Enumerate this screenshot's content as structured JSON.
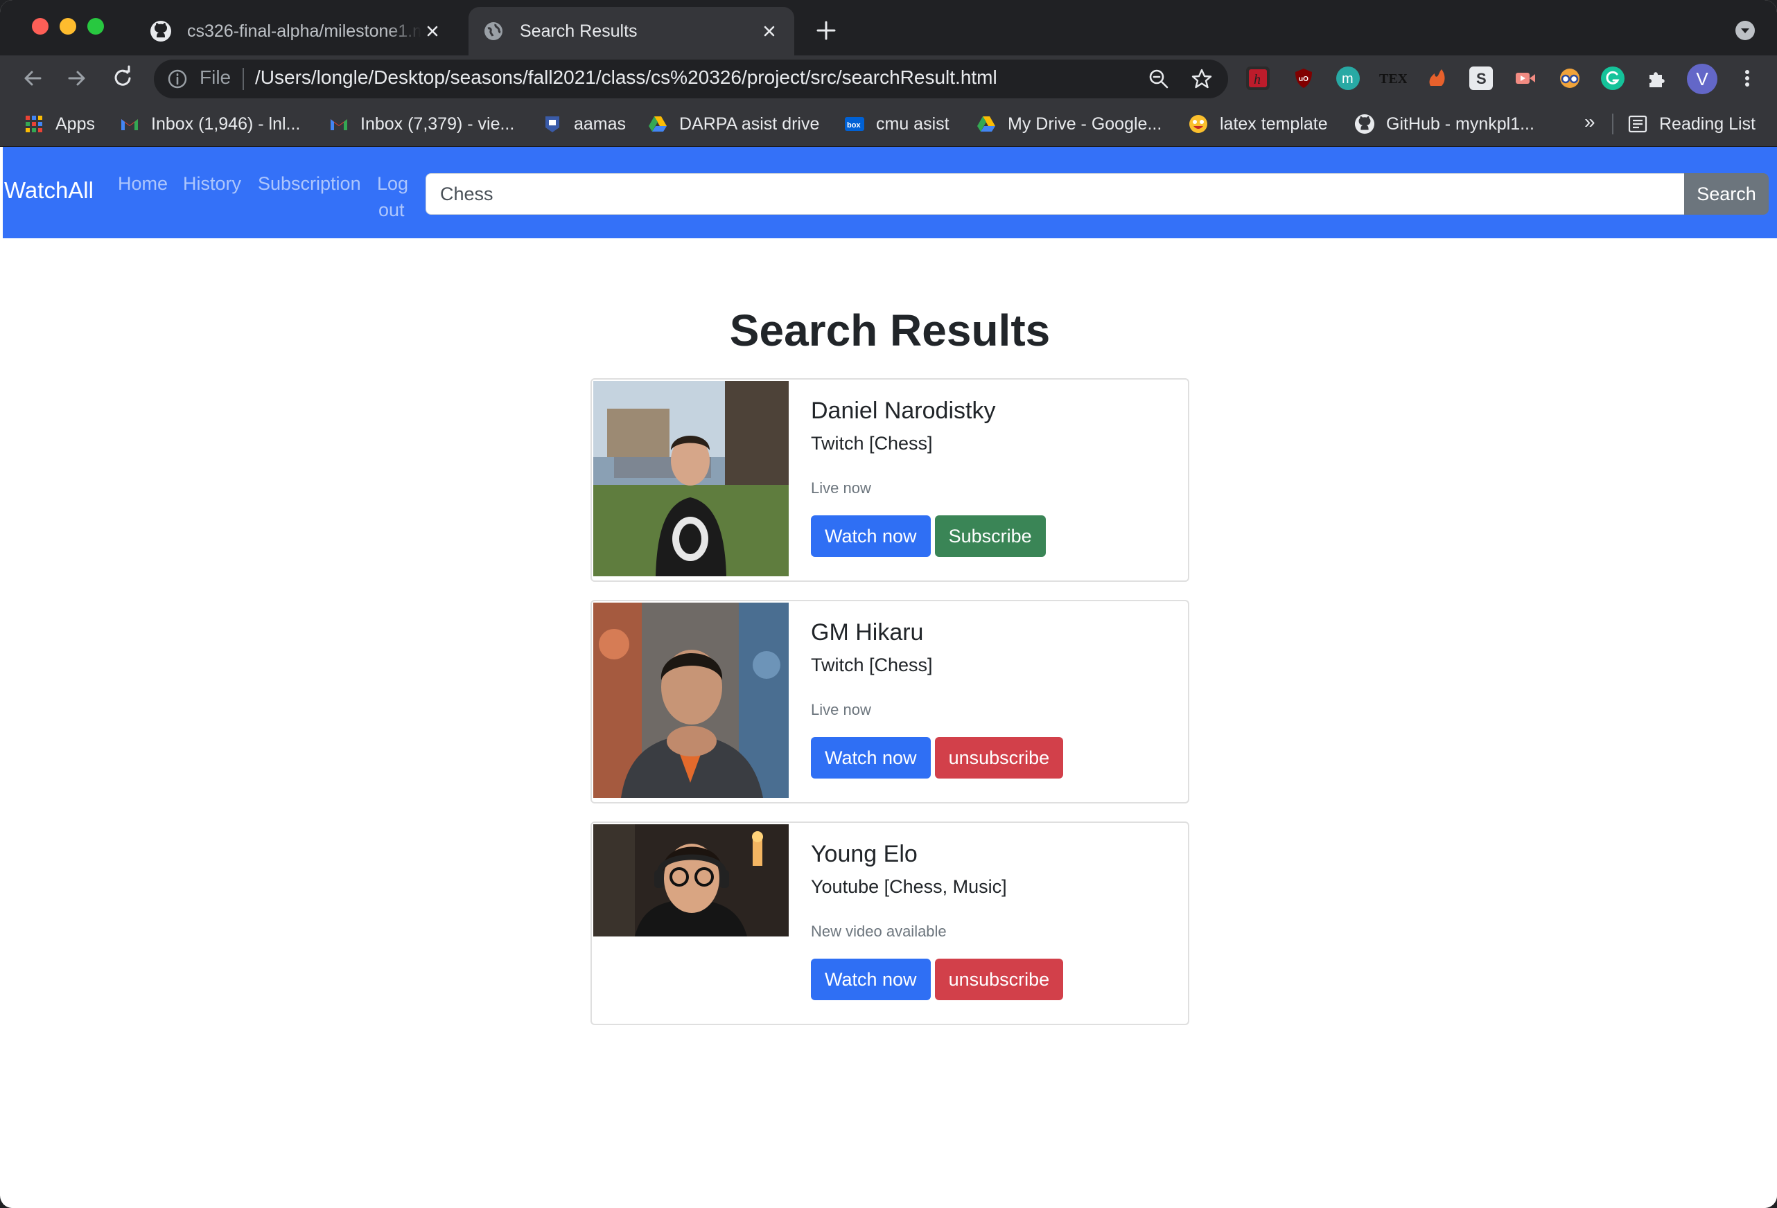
{
  "browser": {
    "tabs": [
      {
        "title": "cs326-final-alpha/milestone1.md",
        "active": false
      },
      {
        "title": "Search Results",
        "active": true
      }
    ],
    "address": {
      "scheme_label": "File",
      "url": "/Users/longle/Desktop/seasons/fall2021/class/cs%20326/project/src/searchResult.html"
    },
    "profile_initial": "V",
    "bookmarks": [
      {
        "label": "Apps",
        "icon": "apps-grid-icon"
      },
      {
        "label": "Inbox (1,946) - lnl...",
        "icon": "gmail-icon"
      },
      {
        "label": "Inbox (7,379) - vie...",
        "icon": "gmail-icon"
      },
      {
        "label": "aamas",
        "icon": "aamas-icon"
      },
      {
        "label": "DARPA asist drive",
        "icon": "google-drive-icon"
      },
      {
        "label": "cmu asist",
        "icon": "box-icon"
      },
      {
        "label": "My Drive - Google...",
        "icon": "google-drive-icon"
      },
      {
        "label": "latex template",
        "icon": "emoji-icon"
      },
      {
        "label": "GitHub - mynkpl1...",
        "icon": "github-icon"
      }
    ],
    "bookmarks_overflow": "»",
    "reading_list": "Reading List",
    "extensions": [
      "hypothesis-icon",
      "ublock-icon",
      "m-extension-icon",
      "tex-icon",
      "fire-extension-icon",
      "s-extension-icon",
      "video-extension-icon",
      "glasses-extension-icon",
      "grammarly-icon",
      "puzzle-icon"
    ]
  },
  "navbar": {
    "brand": "WatchAll",
    "links": {
      "home": "Home",
      "history": "History",
      "subscription": "Subscription",
      "logout_line1": "Log",
      "logout_line2": "out"
    },
    "search": {
      "value": "Chess",
      "button": "Search"
    }
  },
  "page": {
    "title": "Search Results",
    "results": [
      {
        "name": "Daniel Narodistky",
        "platform": "Twitch [Chess]",
        "status": "Live now",
        "watch_label": "Watch now",
        "sub_label": "Subscribe",
        "subscribed": false
      },
      {
        "name": "GM Hikaru",
        "platform": "Twitch [Chess]",
        "status": "Live now",
        "watch_label": "Watch now",
        "sub_label": "unsubscribe",
        "subscribed": true
      },
      {
        "name": "Young Elo",
        "platform": "Youtube [Chess, Music]",
        "status": "New video available",
        "watch_label": "Watch now",
        "sub_label": "unsubscribe",
        "subscribed": true
      }
    ]
  },
  "colors": {
    "navbar": "#3471f8",
    "primary": "#2f6ff4",
    "success": "#3a8556",
    "danger": "#d2404a",
    "secondary": "#6c757d"
  }
}
